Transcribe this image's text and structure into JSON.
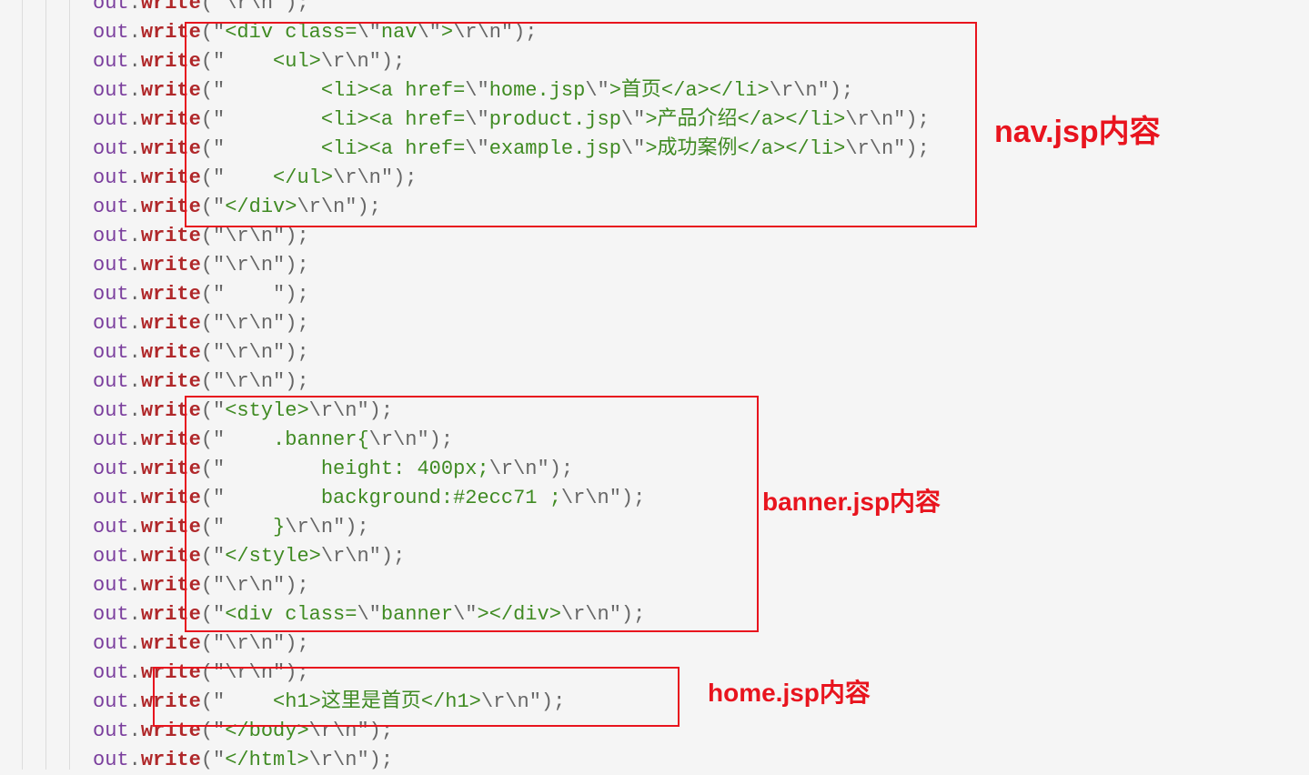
{
  "editor": {
    "object": "out",
    "method": "write",
    "lines": [
      "\\r\\n",
      "<div class=\\\"nav\\\">\\r\\n",
      "    <ul>\\r\\n",
      "        <li><a href=\\\"home.jsp\\\">首页</a></li>\\r\\n",
      "        <li><a href=\\\"product.jsp\\\">产品介绍</a></li>\\r\\n",
      "        <li><a href=\\\"example.jsp\\\">成功案例</a></li>\\r\\n",
      "    </ul>\\r\\n",
      "</div>\\r\\n",
      "\\r\\n",
      "\\r\\n",
      "    ",
      "\\r\\n",
      "\\r\\n",
      "\\r\\n",
      "<style>\\r\\n",
      "    .banner{\\r\\n",
      "        height: 400px;\\r\\n",
      "        background:#2ecc71 ;\\r\\n",
      "    }\\r\\n",
      "</style>\\r\\n",
      "\\r\\n",
      "<div class=\\\"banner\\\"></div>\\r\\n",
      "\\r\\n",
      "\\r\\n",
      "    <h1>这里是首页</h1>\\r\\n",
      "</body>\\r\\n",
      "</html>\\r\\n"
    ]
  },
  "annotations": {
    "nav": "nav.jsp内容",
    "banner": "banner.jsp内容",
    "home": "home.jsp内容"
  },
  "colors": {
    "annotation": "#e8141e",
    "string": "#3f8a22",
    "keyword": "#b0282a",
    "object": "#7a3e9d"
  }
}
